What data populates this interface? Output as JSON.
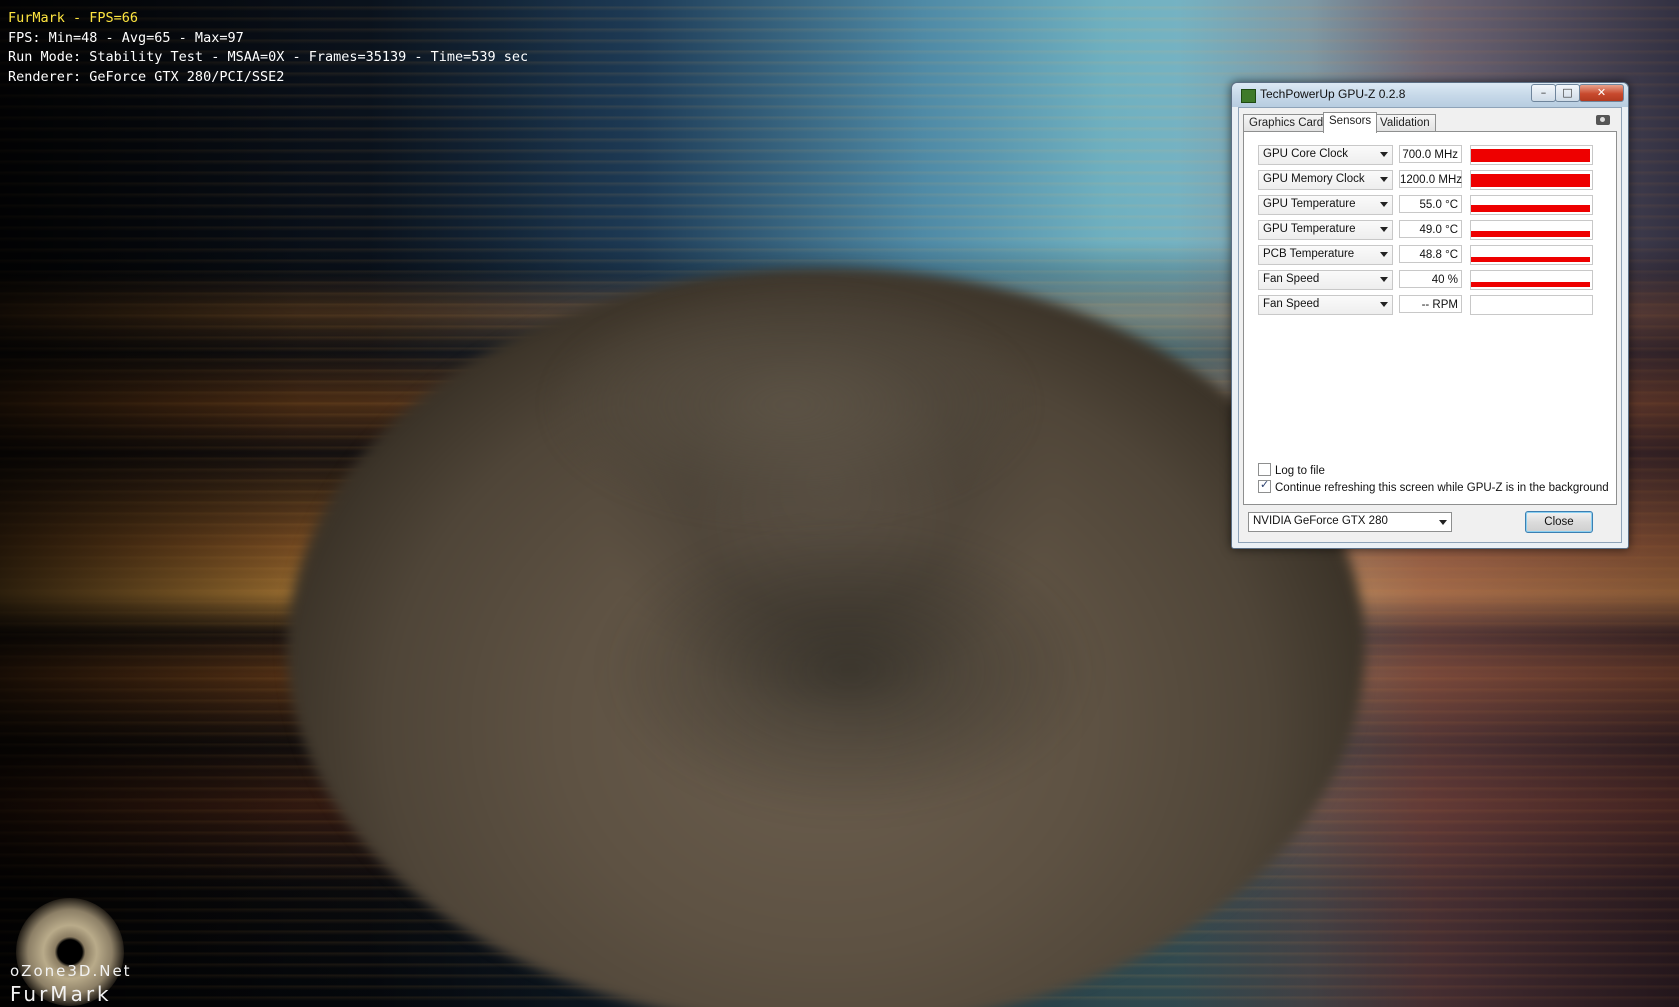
{
  "hud": {
    "line1": "FurMark - FPS=66",
    "line2": "FPS: Min=48 - Avg=65 - Max=97",
    "line3": "Run Mode: Stability Test - MSAA=0X - Frames=35139 - Time=539 sec",
    "line4": "Renderer: GeForce GTX 280/PCI/SSE2"
  },
  "brand": {
    "site": "oZone3D.Net",
    "name": "FurMark"
  },
  "window": {
    "title": "TechPowerUp GPU-Z 0.2.8",
    "minimize_icon": "minimize-icon",
    "maximize_icon": "maximize-icon",
    "close_icon": "close-icon",
    "minimize_glyph": "–",
    "maximize_glyph": "□",
    "close_glyph": "✕"
  },
  "tabs": [
    {
      "label": "Graphics Card",
      "active": false
    },
    {
      "label": "Sensors",
      "active": true
    },
    {
      "label": "Validation",
      "active": false
    }
  ],
  "sensors": [
    {
      "name": "GPU Core Clock",
      "value": "700.0 MHz",
      "level": 1.0
    },
    {
      "name": "GPU Memory Clock",
      "value": "1200.0 MHz",
      "level": 1.0
    },
    {
      "name": "GPU Temperature",
      "value": "55.0 °C",
      "level": 0.5
    },
    {
      "name": "GPU Temperature",
      "value": "49.0 °C",
      "level": 0.45
    },
    {
      "name": "PCB Temperature",
      "value": "48.8 °C",
      "level": 0.4
    },
    {
      "name": "Fan Speed",
      "value": "40 %",
      "level": 0.4
    },
    {
      "name": "Fan Speed",
      "value": "-- RPM",
      "level": 0
    }
  ],
  "options": {
    "log_to_file": {
      "label": "Log to file",
      "checked": false
    },
    "continue_refresh": {
      "label": "Continue refreshing this screen while GPU-Z is in the background",
      "checked": true
    }
  },
  "gpu_select": {
    "value": "NVIDIA GeForce GTX 280"
  },
  "close_button": {
    "label": "Close"
  },
  "colors": {
    "graph": "#ee0000",
    "hud_title": "#ffe640",
    "hud_text": "#ffffff"
  }
}
